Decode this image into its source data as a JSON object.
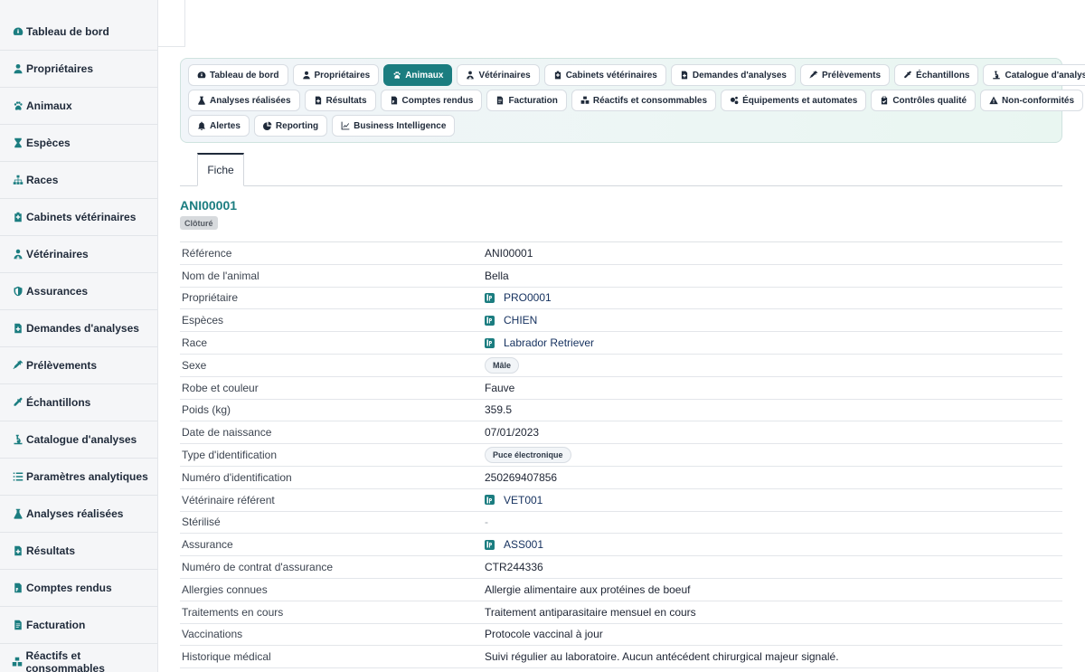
{
  "sidebar": {
    "items": [
      {
        "label": "Tableau de bord",
        "icon": "dashboard-icon"
      },
      {
        "label": "Propriétaires",
        "icon": "user-icon"
      },
      {
        "label": "Animaux",
        "icon": "paw-icon"
      },
      {
        "label": "Espèces",
        "icon": "hourglass-icon"
      },
      {
        "label": "Races",
        "icon": "sitemap-icon"
      },
      {
        "label": "Cabinets vétérinaires",
        "icon": "hospital-icon"
      },
      {
        "label": "Vétérinaires",
        "icon": "doctor-icon"
      },
      {
        "label": "Assurances",
        "icon": "shield-icon"
      },
      {
        "label": "Demandes d'analyses",
        "icon": "file-medical-icon"
      },
      {
        "label": "Prélèvements",
        "icon": "syringe-icon"
      },
      {
        "label": "Échantillons",
        "icon": "eyedropper-icon"
      },
      {
        "label": "Catalogue d'analyses",
        "icon": "microscope-icon"
      },
      {
        "label": "Paramètres analytiques",
        "icon": "list-icon"
      },
      {
        "label": "Analyses réalisées",
        "icon": "flask-icon"
      },
      {
        "label": "Résultats",
        "icon": "file-plus-icon"
      },
      {
        "label": "Comptes rendus",
        "icon": "file-pdf-icon"
      },
      {
        "label": "Facturation",
        "icon": "invoice-icon"
      },
      {
        "label": "Réactifs et consommables",
        "icon": "boxes-icon"
      }
    ]
  },
  "modules": {
    "rows": [
      [
        {
          "label": "Tableau de bord",
          "icon": "dashboard-icon",
          "active": false
        },
        {
          "label": "Propriétaires",
          "icon": "user-icon",
          "active": false
        },
        {
          "label": "Animaux",
          "icon": "paw-icon",
          "active": true
        },
        {
          "label": "Vétérinaires",
          "icon": "doctor-icon",
          "active": false
        },
        {
          "label": "Cabinets vétérinaires",
          "icon": "hospital-icon",
          "active": false
        },
        {
          "label": "Demandes d'analyses",
          "icon": "file-medical-icon",
          "active": false
        },
        {
          "label": "Prélèvements",
          "icon": "syringe-icon",
          "active": false
        },
        {
          "label": "Échantillons",
          "icon": "eyedropper-icon",
          "active": false
        },
        {
          "label": "Catalogue d'analyses",
          "icon": "microscope-icon",
          "active": false
        }
      ],
      [
        {
          "label": "Analyses réalisées",
          "icon": "flask-icon",
          "active": false
        },
        {
          "label": "Résultats",
          "icon": "file-plus-icon",
          "active": false
        },
        {
          "label": "Comptes rendus",
          "icon": "file-pdf-icon",
          "active": false
        },
        {
          "label": "Facturation",
          "icon": "invoice-icon",
          "active": false
        },
        {
          "label": "Réactifs et consommables",
          "icon": "boxes-icon",
          "active": false
        },
        {
          "label": "Équipements et automates",
          "icon": "cogs-icon",
          "active": false
        },
        {
          "label": "Contrôles qualité",
          "icon": "clipboard-check-icon",
          "active": false
        },
        {
          "label": "Non-conformités",
          "icon": "warning-icon",
          "active": false
        }
      ],
      [
        {
          "label": "Alertes",
          "icon": "bell-icon",
          "active": false
        },
        {
          "label": "Reporting",
          "icon": "pie-chart-icon",
          "active": false
        },
        {
          "label": "Business Intelligence",
          "icon": "line-chart-icon",
          "active": false
        }
      ]
    ]
  },
  "subtab": {
    "label": "Fiche"
  },
  "record": {
    "title": "ANI00001",
    "status": "Clôturé",
    "fields": [
      {
        "label": "Référence",
        "value": "ANI00001",
        "type": "text"
      },
      {
        "label": "Nom de l'animal",
        "value": "Bella",
        "type": "text"
      },
      {
        "label": "Propriétaire",
        "value": "PRO0001",
        "type": "link"
      },
      {
        "label": "Espèces",
        "value": "CHIEN",
        "type": "link"
      },
      {
        "label": "Race",
        "value": "Labrador Retriever",
        "type": "link"
      },
      {
        "label": "Sexe",
        "value": "Mâle",
        "type": "chip"
      },
      {
        "label": "Robe et couleur",
        "value": "Fauve",
        "type": "text"
      },
      {
        "label": "Poids (kg)",
        "value": "359.5",
        "type": "text"
      },
      {
        "label": "Date de naissance",
        "value": "07/01/2023",
        "type": "text"
      },
      {
        "label": "Type d'identification",
        "value": "Puce électronique",
        "type": "chip"
      },
      {
        "label": "Numéro d'identification",
        "value": "250269407856",
        "type": "text"
      },
      {
        "label": "Vétérinaire référent",
        "value": "VET001",
        "type": "link"
      },
      {
        "label": "Stérilisé",
        "value": "-",
        "type": "muted"
      },
      {
        "label": "Assurance",
        "value": "ASS001",
        "type": "link"
      },
      {
        "label": "Numéro de contrat d'assurance",
        "value": "CTR244336",
        "type": "text"
      },
      {
        "label": "Allergies connues",
        "value": "Allergie alimentaire aux protéines de boeuf",
        "type": "text"
      },
      {
        "label": "Traitements en cours",
        "value": "Traitement antiparasitaire mensuel en cours",
        "type": "text"
      },
      {
        "label": "Vaccinations",
        "value": "Protocole vaccinal à jour",
        "type": "text"
      },
      {
        "label": "Historique médical",
        "value": "Suivi régulier au laboratoire. Aucun antécédent chirurgical majeur signalé.",
        "type": "text"
      }
    ]
  },
  "colors": {
    "accent": "#1b7d80",
    "link": "#14305e",
    "status_bg": "#d7dadd"
  }
}
